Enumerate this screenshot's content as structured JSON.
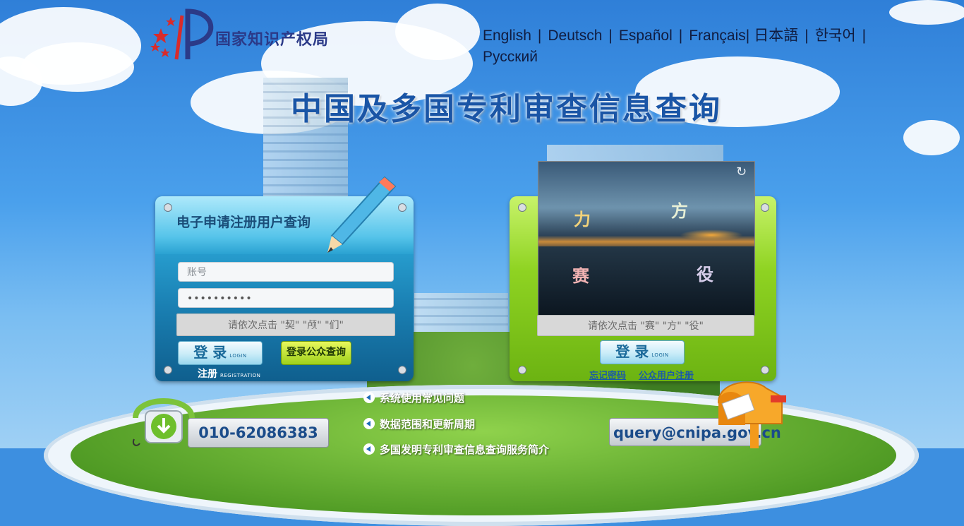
{
  "header": {
    "logo_text": "国家知识产权局",
    "languages": [
      "English",
      "Deutsch",
      "Español",
      "Français",
      "日本語",
      "한국어",
      "Русский"
    ],
    "title": "中国及多国专利审查信息查询"
  },
  "left_panel": {
    "title": "电子申请注册用户查询",
    "account_placeholder": "账号",
    "password_value": "••••••••••",
    "captcha_hint": "请依次点击 \"契\" \"颅\" \"们\"",
    "login_label": "登 录",
    "login_sub": "LOGIN",
    "public_query_label": "登录公众查询",
    "register_label": "注册",
    "register_sub": "REGISTRATION"
  },
  "right_panel": {
    "captcha_chars": [
      {
        "char": "力",
        "color": "#f2d27a"
      },
      {
        "char": "方",
        "color": "#e8f0d6"
      },
      {
        "char": "赛",
        "color": "#f2b3b3"
      },
      {
        "char": "役",
        "color": "#d6cdea"
      }
    ],
    "captcha_hint": "请依次点击 \"赛\" \"方\" \"役\"",
    "login_label": "登 录",
    "login_sub": "LOGIN",
    "forgot_password": "忘记密码",
    "public_register": "公众用户注册"
  },
  "footer": {
    "phone": "010-62086383",
    "email": "query@cnipa.gov.cn",
    "links": [
      "系统使用常见问题",
      "数据范围和更新周期",
      "多国发明专利审查信息查询服务简介"
    ]
  },
  "colors": {
    "title_blue": "#1a55a6",
    "panel_blue": "#1a7fb2",
    "panel_green": "#8fd322",
    "link_blue": "#1a5aa8"
  }
}
